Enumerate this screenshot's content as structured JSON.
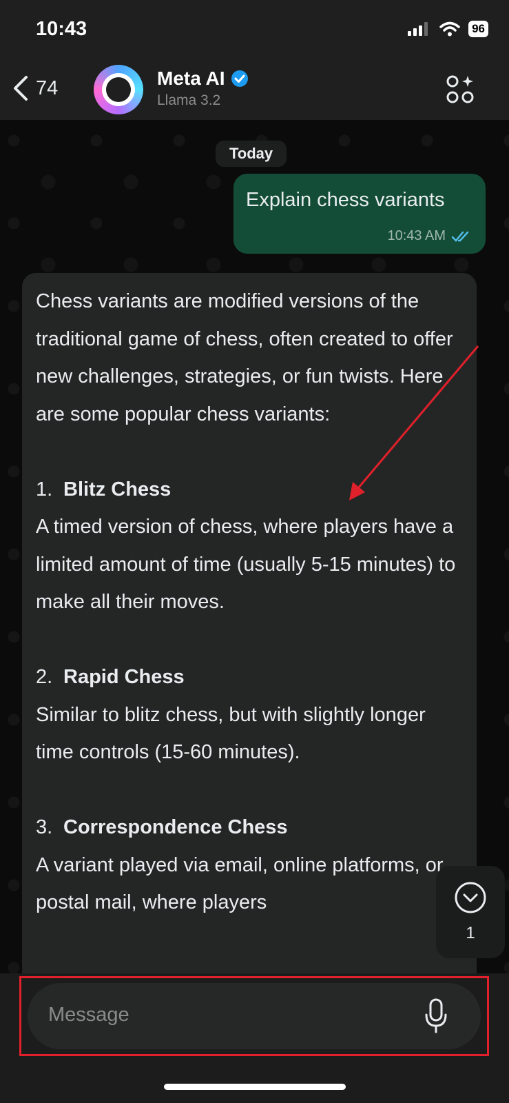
{
  "status": {
    "time": "10:43",
    "battery": "96"
  },
  "header": {
    "back_count": "74",
    "title": "Meta AI",
    "subtitle": "Llama 3.2"
  },
  "chat": {
    "date": "Today",
    "outgoing": {
      "text": "Explain chess variants",
      "time": "10:43 AM"
    },
    "incoming": {
      "intro": "Chess variants are modified versions of the traditional game of chess, often created to offer new challenges, strategies, or fun twists. Here are some popular chess variants:",
      "items": [
        {
          "num": "1.",
          "title": "Blitz Chess",
          "desc": "A timed version of chess, where players have a limited amount of time (usually 5-15 minutes) to make all their moves."
        },
        {
          "num": "2.",
          "title": "Rapid Chess",
          "desc": "Similar to blitz chess, but with slightly longer time controls (15-60 minutes)."
        },
        {
          "num": "3.",
          "title": "Correspondence Chess",
          "desc": "A variant played via email, online platforms, or postal mail, where players"
        }
      ]
    },
    "scroll_count": "1"
  },
  "composer": {
    "placeholder": "Message"
  },
  "colors": {
    "outgoing_bubble": "#144d37",
    "incoming_bubble": "#242626",
    "annotation": "#e0202a",
    "read_ticks": "#53bdeb",
    "verified": "#1d9bf0"
  }
}
